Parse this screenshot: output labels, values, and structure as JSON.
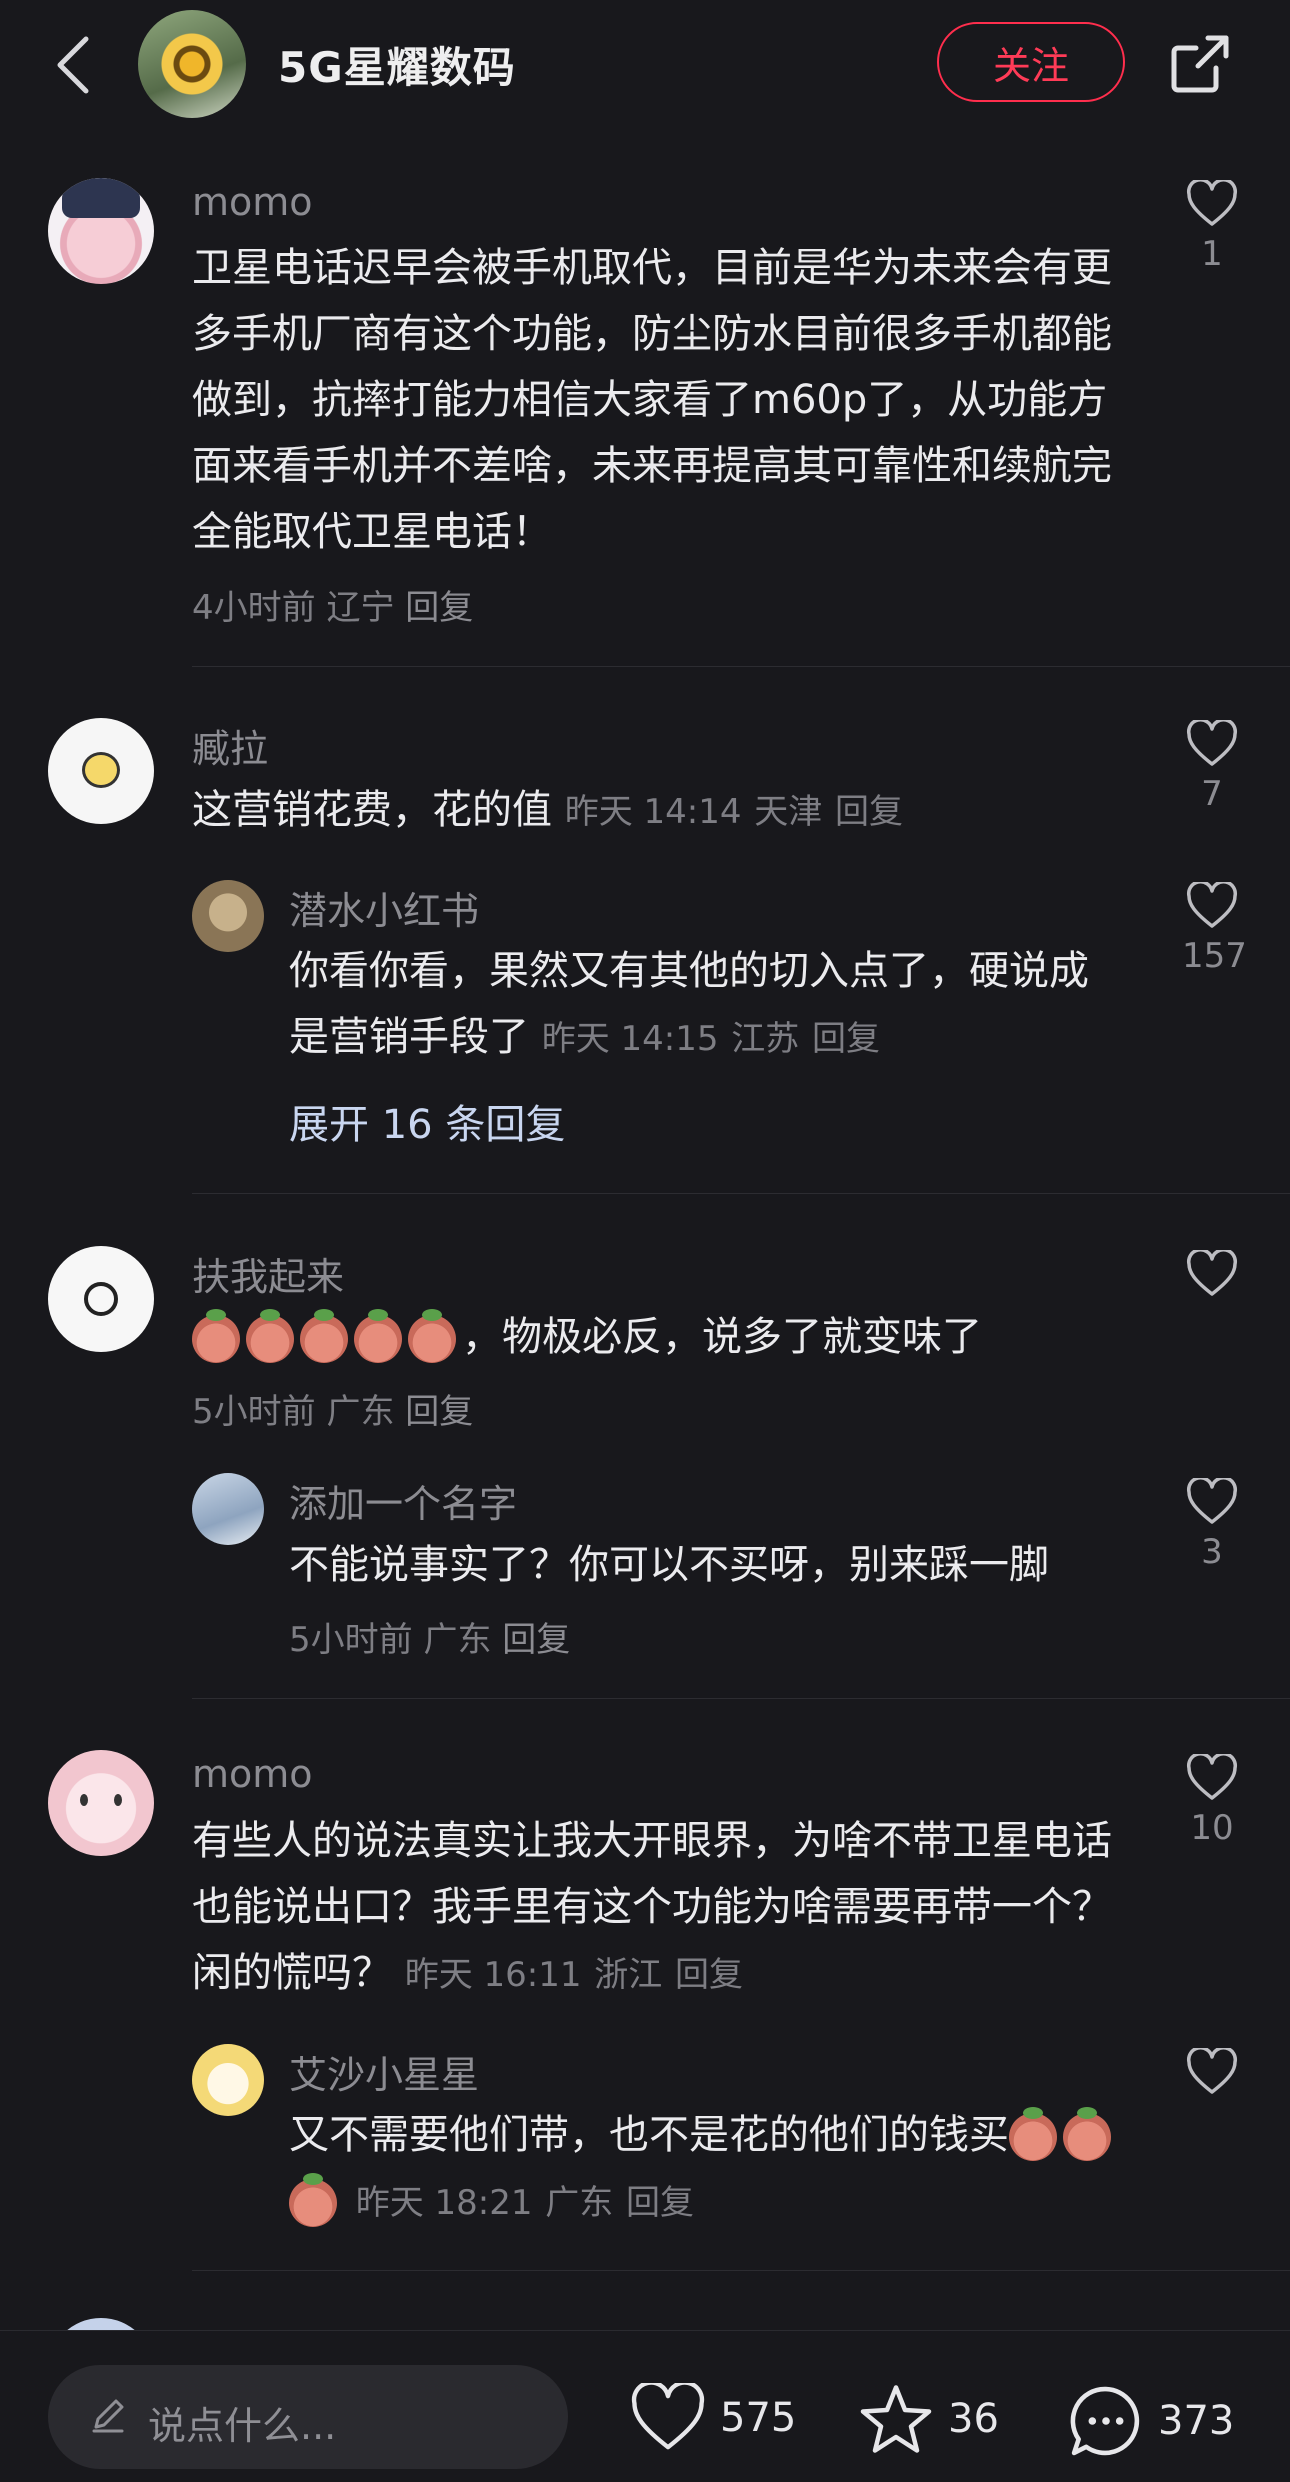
{
  "header": {
    "channel_name": "5G星耀数码",
    "follow_label": "关注"
  },
  "comments": [
    {
      "user": "momo",
      "text": "卫星电话迟早会被手机取代，目前是华为未来会有更多手机厂商有这个功能，防尘防水目前很多手机都能做到，抗摔打能力相信大家看了m60p了，从功能方面来看手机并不差啥，未来再提高其可靠性和续航完全能取代卫星电话！",
      "time": "4小时前",
      "location": "辽宁",
      "reply_label": "回复",
      "likes": "1"
    },
    {
      "user": "臧拉",
      "text": "这营销花费，花的值",
      "time": "昨天 14:14",
      "location": "天津",
      "reply_label": "回复",
      "likes": "7",
      "replies": [
        {
          "user": "潜水小红书",
          "text": "你看你看，果然又有其他的切入点了，硬说成是营销手段了",
          "time": "昨天 14:15",
          "location": "江苏",
          "reply_label": "回复",
          "likes": "157"
        }
      ],
      "expand_label": "展开 16 条回复"
    },
    {
      "user": "扶我起来",
      "text": "，物极必反，说多了就变味了",
      "time": "5小时前",
      "location": "广东",
      "reply_label": "回复",
      "likes": "",
      "replies": [
        {
          "user": "添加一个名字",
          "text": "不能说事实了？你可以不买呀，别来踩一脚",
          "time": "5小时前",
          "location": "广东",
          "reply_label": "回复",
          "likes": "3"
        }
      ]
    },
    {
      "user": "momo",
      "text": "有些人的说法真实让我大开眼界，为啥不带卫星电话也能说出口？我手里有这个功能为啥需要再带一个？闲的慌吗？",
      "time": "昨天 16:11",
      "location": "浙江",
      "reply_label": "回复",
      "likes": "10",
      "replies": [
        {
          "user": "艾沙小星星",
          "text": "又不需要他们带，也不是花的他们的钱买",
          "time": "昨天 18:21",
          "location": "广东",
          "reply_label": "回复",
          "likes": ""
        }
      ]
    }
  ],
  "bottom_bar": {
    "input_placeholder": "说点什么...",
    "like_count": "575",
    "collect_count": "36",
    "comment_count": "373"
  },
  "colors": {
    "background": "#18181c",
    "follow_accent": "#ff2e4d",
    "expand_link": "#c9d6f0"
  }
}
